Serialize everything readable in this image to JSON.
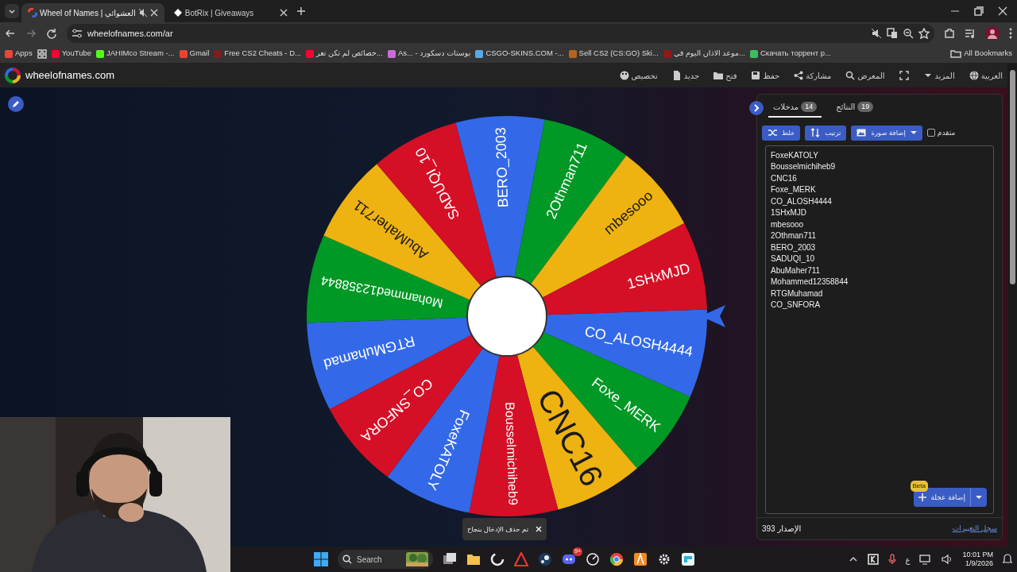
{
  "browser": {
    "tabs": [
      {
        "title": "BotRix | Giveaways",
        "selected": false,
        "muted": false
      },
      {
        "title": "Wheel of Names | العشوائي",
        "selected": true,
        "muted": true
      }
    ],
    "address": "wheelofnames.com/ar",
    "bookmarks": [
      {
        "label": "Скачать торрент р...",
        "color": "#3dbd5d"
      },
      {
        "label": "موعد الاذان اليوم في...",
        "color": "#8b1a1a"
      },
      {
        "label": "Sell CS2 (CS:GO) Ski...",
        "color": "#b5651d"
      },
      {
        "label": "CSGO-SKINS.COM -...",
        "color": "#5aa9e6"
      },
      {
        "label": "As... - بوستات دسكورد",
        "color": "#c86dd7"
      },
      {
        "label": "خصائص لم تكن تعر...",
        "color": "#ff0033"
      },
      {
        "label": "Free CS2 Cheats - D...",
        "color": "#7a1f1f"
      },
      {
        "label": "Gmail",
        "color": "#ea4335"
      },
      {
        "label": "JAHIMco Stream -...",
        "color": "#53fc18"
      },
      {
        "label": "YouTube",
        "color": "#ff0033"
      },
      {
        "label": "Apps",
        "color": "#e8453c"
      }
    ],
    "all_bookmarks": "All Bookmarks"
  },
  "app": {
    "logo": "wheelofnames.com",
    "nav": [
      {
        "label": "العربية"
      },
      {
        "label": "المزيد"
      },
      {
        "label": "المعرض"
      },
      {
        "label": "مشاركة"
      },
      {
        "label": "حفظ"
      },
      {
        "label": "فتح"
      },
      {
        "label": "جديد"
      },
      {
        "label": "تخصيص"
      }
    ]
  },
  "wheel": {
    "segments": [
      {
        "label": "CO_ALOSH4444",
        "color": "#3369e8"
      },
      {
        "label": "Foxe_MERK",
        "color": "#009925"
      },
      {
        "label": "CNC16",
        "color": "#eeb211"
      },
      {
        "label": "Bousselmichiheb9",
        "color": "#d50f25"
      },
      {
        "label": "FoxeKATOLY",
        "color": "#3369e8"
      },
      {
        "label": "CO_SNFORA",
        "color": "#d50f25"
      },
      {
        "label": "RTGMuhamad",
        "color": "#3369e8"
      },
      {
        "label": "Mohammed12358844",
        "color": "#009925"
      },
      {
        "label": "AbuMaher711",
        "color": "#eeb211"
      },
      {
        "label": "SADUQI_10",
        "color": "#d50f25"
      },
      {
        "label": "BERO_2003",
        "color": "#3369e8"
      },
      {
        "label": "2Othman711",
        "color": "#009925"
      },
      {
        "label": "mbesooo",
        "color": "#eeb211"
      },
      {
        "label": "1SHxMJD",
        "color": "#d50f25"
      }
    ]
  },
  "panel": {
    "tabs": [
      {
        "label": "النتائج",
        "count": "19",
        "selected": false
      },
      {
        "label": "مدخلات",
        "count": "14",
        "selected": true
      }
    ],
    "advanced": {
      "label": "متقدم",
      "checked": false
    },
    "buttons": [
      {
        "label": "إضافة صورة"
      },
      {
        "label": "ترتيب"
      },
      {
        "label": "خلط"
      }
    ],
    "entries": [
      "FoxeKATOLY",
      "Bousselmichiheb9",
      "CNC16",
      "Foxe_MERK",
      "CO_ALOSH4444",
      "1SHxMJD",
      "mbesooo",
      "2Othman711",
      "BERO_2003",
      "SADUQI_10",
      "AbuMaher711",
      "Mohammed12358844",
      "RTGMuhamad",
      "CO_SNFORA"
    ],
    "add_wheel": {
      "label": "إضافة عجلة",
      "badge": "Beta"
    },
    "version": "الإصدار 393",
    "changelog": "سجل التغييرات"
  },
  "toast": {
    "message": "تم حذف الإدخال بنجاح"
  },
  "taskbar": {
    "search_placeholder": "Search",
    "notification_badge": "9+",
    "language": "ع",
    "time": "10:01 PM",
    "date": "1/9/2026"
  }
}
